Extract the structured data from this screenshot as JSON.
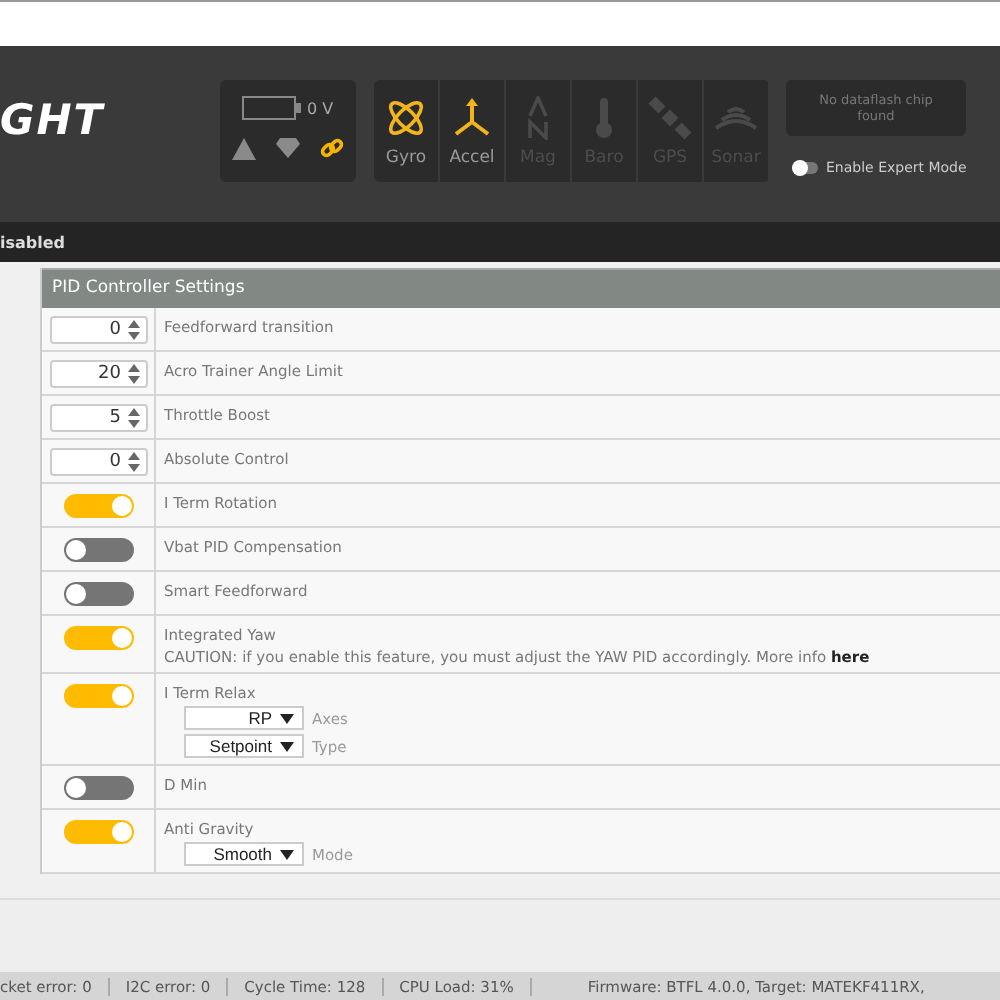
{
  "header": {
    "logo": "GHT",
    "battery": {
      "voltage": "0 V"
    },
    "status_icons": [
      {
        "kind": "warning",
        "active": false
      },
      {
        "kind": "diamond",
        "active": false
      },
      {
        "kind": "link",
        "active": true
      }
    ],
    "sensors": [
      {
        "kind": "gyro",
        "label": "Gyro",
        "on": true
      },
      {
        "kind": "accel",
        "label": "Accel",
        "on": true
      },
      {
        "kind": "mag",
        "label": "Mag",
        "on": false
      },
      {
        "kind": "baro",
        "label": "Baro",
        "on": false
      },
      {
        "kind": "gps",
        "label": "GPS",
        "on": false
      },
      {
        "kind": "sonar",
        "label": "Sonar",
        "on": false
      }
    ],
    "dataflash": "No dataflash chip found",
    "expert_mode": {
      "label": "Enable Expert Mode",
      "on": false
    }
  },
  "banner": "isabled",
  "panel": {
    "title": "PID Controller Settings",
    "rows": [
      {
        "kind": "number",
        "value": "0",
        "label": "Feedforward transition"
      },
      {
        "kind": "number",
        "value": "20",
        "label": "Acro Trainer Angle Limit"
      },
      {
        "kind": "number",
        "value": "5",
        "label": "Throttle Boost"
      },
      {
        "kind": "number",
        "value": "0",
        "label": "Absolute Control"
      },
      {
        "kind": "toggle",
        "on": true,
        "label": "I Term Rotation"
      },
      {
        "kind": "toggle",
        "on": false,
        "label": "Vbat PID Compensation"
      },
      {
        "kind": "toggle",
        "on": false,
        "label": "Smart Feedforward"
      },
      {
        "kind": "toggle",
        "on": true,
        "label": "Integrated Yaw",
        "note": "CAUTION: if you enable this feature, you must adjust the YAW PID accordingly. More info",
        "link": "here"
      },
      {
        "kind": "toggle",
        "on": true,
        "label": "I Term Relax",
        "selects": [
          {
            "value": "RP",
            "label": "Axes"
          },
          {
            "value": "Setpoint",
            "label": "Type"
          }
        ]
      },
      {
        "kind": "toggle",
        "on": false,
        "label": "D Min"
      },
      {
        "kind": "toggle",
        "on": true,
        "label": "Anti Gravity",
        "selects": [
          {
            "value": "Smooth",
            "label": "Mode"
          }
        ]
      }
    ]
  },
  "status_bar": [
    "cket error: 0",
    "I2C error: 0",
    "Cycle Time: 128",
    "CPU Load: 31%",
    "Firmware: BTFL 4.0.0, Target: MATEKF411RX,"
  ]
}
